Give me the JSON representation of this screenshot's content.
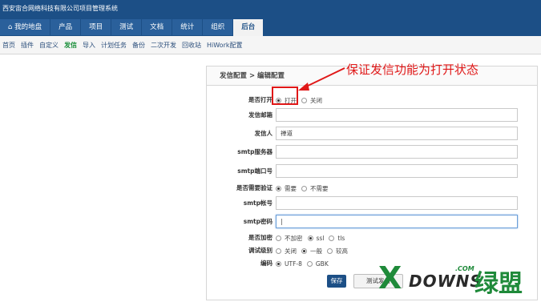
{
  "app": {
    "title": "西安宙合网络科技有限公司项目管理系统"
  },
  "main_nav": [
    {
      "label": "我的地盘",
      "icon": "home-icon",
      "active": false
    },
    {
      "label": "产品",
      "active": false
    },
    {
      "label": "项目",
      "active": false
    },
    {
      "label": "测试",
      "active": false
    },
    {
      "label": "文档",
      "active": false
    },
    {
      "label": "统计",
      "active": false
    },
    {
      "label": "组织",
      "active": false
    },
    {
      "label": "后台",
      "active": true
    }
  ],
  "sub_nav": [
    {
      "label": "首页",
      "active": false
    },
    {
      "label": "插件",
      "active": false
    },
    {
      "label": "自定义",
      "active": false
    },
    {
      "label": "发信",
      "active": true
    },
    {
      "label": "导入",
      "active": false
    },
    {
      "label": "计划任务",
      "active": false
    },
    {
      "label": "备份",
      "active": false
    },
    {
      "label": "二次开发",
      "active": false
    },
    {
      "label": "回收站",
      "active": false
    },
    {
      "label": "HiWork配置",
      "active": false
    }
  ],
  "panel": {
    "breadcrumb": "发信配置 > 编辑配置",
    "turnon": {
      "label": "是否打开",
      "options": [
        "打开",
        "关闭"
      ],
      "selected": "打开"
    },
    "mail_from": {
      "label": "发信邮箱",
      "value": ""
    },
    "sender": {
      "label": "发信人",
      "value": "禅道"
    },
    "smtp_host": {
      "label": "smtp服务器",
      "value": ""
    },
    "smtp_port": {
      "label": "smtp端口号",
      "value": ""
    },
    "auth": {
      "label": "是否需要验证",
      "options": [
        "需要",
        "不需要"
      ],
      "selected": "需要"
    },
    "smtp_user": {
      "label": "smtp帐号",
      "value": ""
    },
    "smtp_pass": {
      "label": "smtp密码",
      "value": ""
    },
    "secure": {
      "label": "是否加密",
      "options": [
        "不加密",
        "ssl",
        "tls"
      ],
      "selected": "ssl"
    },
    "debug": {
      "label": "调试级别",
      "options": [
        "关闭",
        "一般",
        "较高"
      ],
      "selected": "一般"
    },
    "charset": {
      "label": "编码",
      "options": [
        "UTF-8",
        "GBK"
      ],
      "selected": "UTF-8"
    },
    "save_label": "保存",
    "test_label": "测试发信"
  },
  "annotation": {
    "text": "保证发信功能为打开状态",
    "color": "#e01818"
  },
  "watermark": {
    "x": "X",
    "word": "DOWNS",
    "com": ".COM",
    "cn": "绿盟"
  },
  "colors": {
    "nav_bg": "#1c4f86",
    "tab_bg": "#2a609b",
    "active_subnav": "#1a8f3a",
    "watermark_green": "#1f8a3a"
  }
}
